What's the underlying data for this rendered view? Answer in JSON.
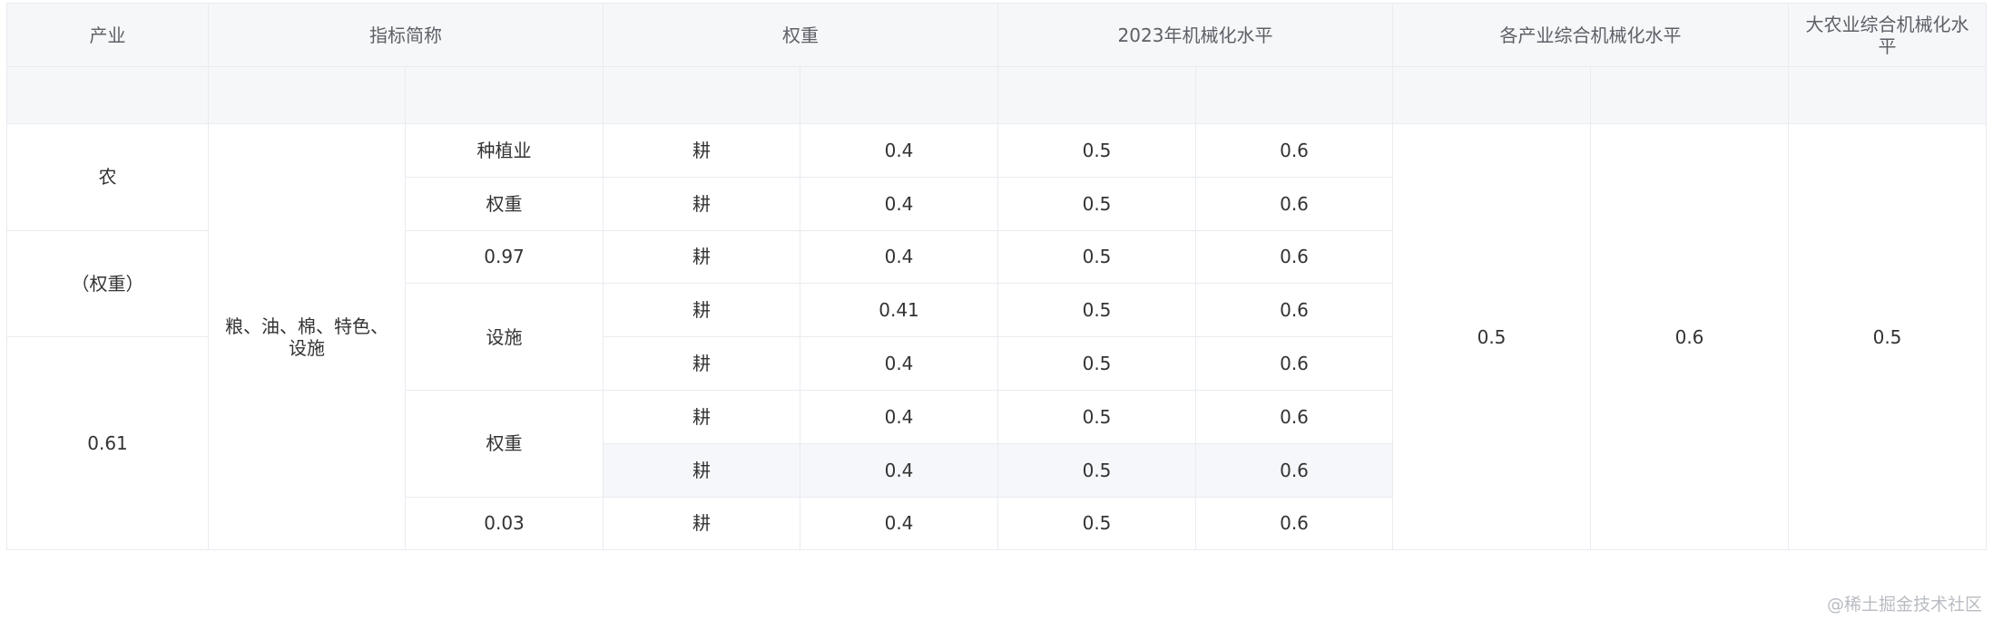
{
  "header": {
    "industry": "产业",
    "indicator": "指标简称",
    "weight": "权重",
    "level_2023": "2023年机械化水平",
    "industry_level": "各产业综合机械化水平",
    "overall_level": "大农业综合机械化水平"
  },
  "industry_cells": [
    "农",
    "（权重）",
    "0.61"
  ],
  "indicator_name": "粮、油、棉、特色、设施",
  "category_cells": [
    "种植业",
    "权重",
    "0.97",
    "设施",
    "权重",
    "0.03"
  ],
  "rows": [
    {
      "stage": "耕",
      "weight": "0.4",
      "a": "0.5",
      "b": "0.6"
    },
    {
      "stage": "耕",
      "weight": "0.4",
      "a": "0.5",
      "b": "0.6"
    },
    {
      "stage": "耕",
      "weight": "0.4",
      "a": "0.5",
      "b": "0.6"
    },
    {
      "stage": "耕",
      "weight": "0.41",
      "a": "0.5",
      "b": "0.6"
    },
    {
      "stage": "耕",
      "weight": "0.4",
      "a": "0.5",
      "b": "0.6"
    },
    {
      "stage": "耕",
      "weight": "0.4",
      "a": "0.5",
      "b": "0.6"
    },
    {
      "stage": "耕",
      "weight": "0.4",
      "a": "0.5",
      "b": "0.6"
    },
    {
      "stage": "耕",
      "weight": "0.4",
      "a": "0.5",
      "b": "0.6"
    }
  ],
  "summary": {
    "industry_a": "0.5",
    "industry_b": "0.6",
    "overall": "0.5"
  },
  "watermark": "@稀土掘金技术社区"
}
